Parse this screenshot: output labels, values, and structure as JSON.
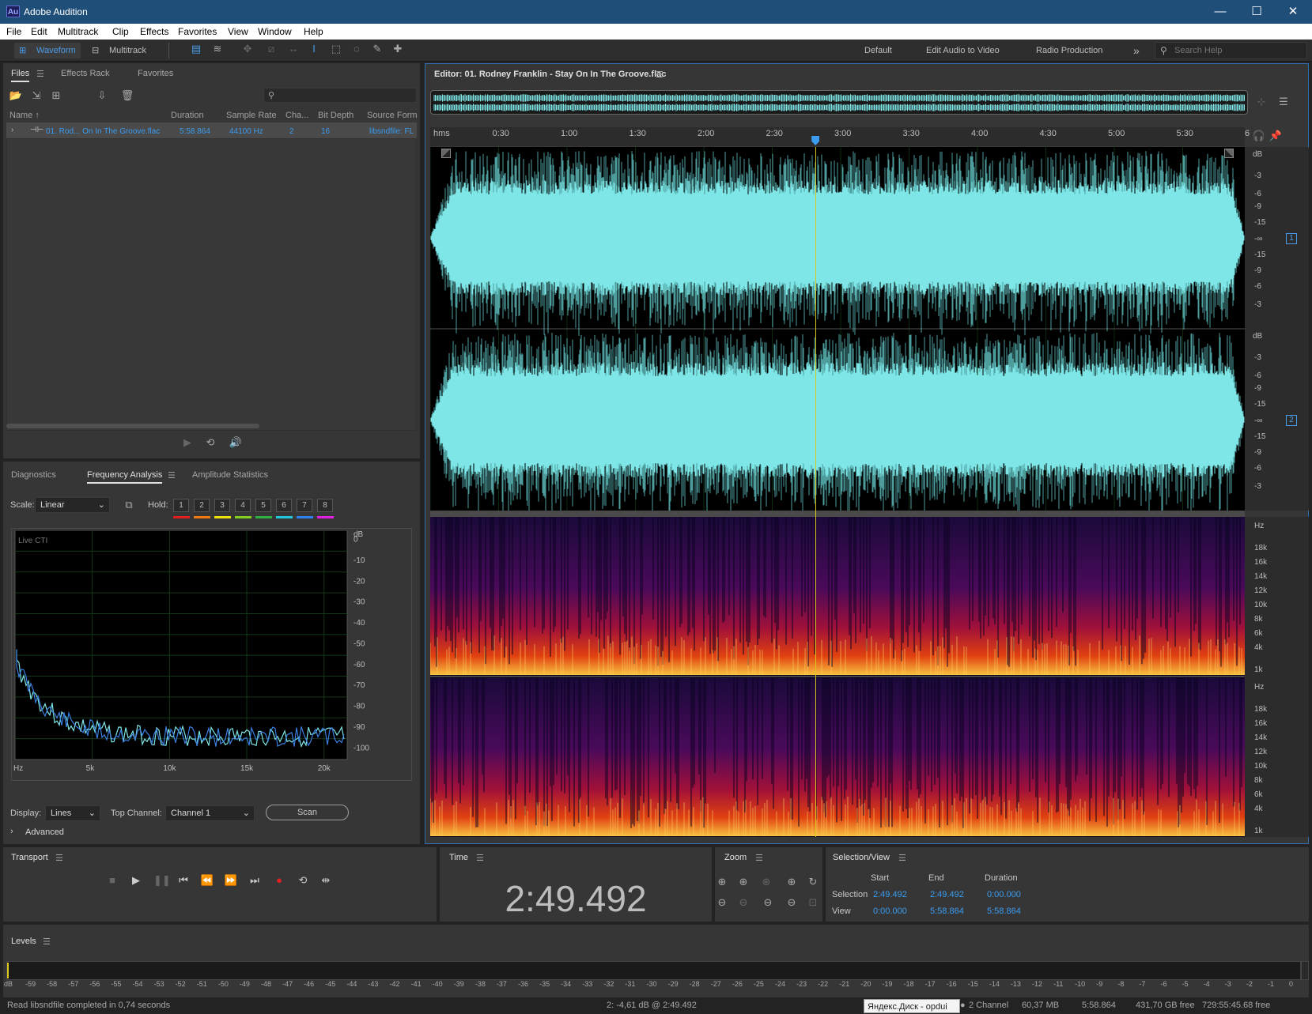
{
  "app": {
    "logo": "Au",
    "title": "Adobe Audition"
  },
  "window_controls": {
    "minimize": "—",
    "maximize": "☐",
    "close": "✕"
  },
  "menu": [
    "File",
    "Edit",
    "Multitrack",
    "Clip",
    "Effects",
    "Favorites",
    "View",
    "Window",
    "Help"
  ],
  "toolbar": {
    "waveform_label": "Waveform",
    "multitrack_label": "Multitrack"
  },
  "workspaces": [
    "Default",
    "Edit Audio to Video",
    "Radio Production"
  ],
  "overflow_label": "»",
  "search_help": {
    "placeholder": "Search Help"
  },
  "files_panel": {
    "tabs": [
      "Files",
      "Effects Rack",
      "Favorites"
    ],
    "columns": [
      "Name ↑",
      "Duration",
      "Sample Rate",
      "Cha...",
      "Bit Depth",
      "Source Form..."
    ],
    "file": {
      "name": "01. Rod... On In The Groove.flac",
      "duration": "5:58.864",
      "sample_rate": "44100 Hz",
      "channels": "2",
      "bit_depth": "16",
      "source_format": "libsndfile: FL"
    }
  },
  "analysis_panel": {
    "tabs": [
      "Diagnostics",
      "Frequency Analysis",
      "Amplitude Statistics"
    ],
    "scale_label": "Scale:",
    "scale_value": "Linear",
    "hold_label": "Hold:",
    "hold_buttons": [
      "1",
      "2",
      "3",
      "4",
      "5",
      "6",
      "7",
      "8"
    ],
    "hold_colors": [
      "#e0201c",
      "#f07a10",
      "#f0e010",
      "#80d020",
      "#30b040",
      "#20c8e0",
      "#3080f0",
      "#e020e0"
    ],
    "graph_label": "Live CTI",
    "x_ticks": [
      "Hz",
      "5k",
      "10k",
      "15k",
      "20k"
    ],
    "db_ticks": [
      "dB",
      "0",
      "-10",
      "-20",
      "-30",
      "-40",
      "-50",
      "-60",
      "-70",
      "-80",
      "-90",
      "-100"
    ],
    "display_label": "Display:",
    "display_value": "Lines",
    "top_channel_label": "Top Channel:",
    "top_channel_value": "Channel 1",
    "scan_label": "Scan",
    "advanced_label": "Advanced"
  },
  "editor": {
    "title": "Editor: 01. Rodney Franklin - Stay On In The Groove.flac",
    "ruler": [
      "hms",
      "0:30",
      "1:00",
      "1:30",
      "2:00",
      "2:30",
      "3:00",
      "3:30",
      "4:00",
      "4:30",
      "5:00",
      "5:30",
      "6"
    ],
    "db_scale": [
      "dB",
      "-3",
      "-6",
      "-9",
      "-15",
      "-∞",
      "-15",
      "-9",
      "-6",
      "-3"
    ],
    "hz_scale": [
      "Hz",
      "18k",
      "16k",
      "14k",
      "12k",
      "10k",
      "8k",
      "6k",
      "4k",
      "1k"
    ],
    "channel_1": "1",
    "channel_2": "2",
    "playhead_fraction": 0.473
  },
  "transport": {
    "title": "Transport"
  },
  "time": {
    "title": "Time",
    "value": "2:49.492"
  },
  "zoom": {
    "title": "Zoom"
  },
  "selection_view": {
    "title": "Selection/View",
    "headers": [
      "Start",
      "End",
      "Duration"
    ],
    "rows": [
      {
        "label": "Selection",
        "start": "2:49.492",
        "end": "2:49.492",
        "duration": "0:00.000"
      },
      {
        "label": "View",
        "start": "0:00.000",
        "end": "5:58.864",
        "duration": "5:58.864"
      }
    ]
  },
  "levels": {
    "title": "Levels",
    "ticks": [
      "dB",
      "-59",
      "-58",
      "-57",
      "-56",
      "-55",
      "-54",
      "-53",
      "-52",
      "-51",
      "-50",
      "-49",
      "-48",
      "-47",
      "-46",
      "-45",
      "-44",
      "-43",
      "-42",
      "-41",
      "-40",
      "-39",
      "-38",
      "-37",
      "-36",
      "-35",
      "-34",
      "-33",
      "-32",
      "-31",
      "-30",
      "-29",
      "-28",
      "-27",
      "-26",
      "-25",
      "-24",
      "-23",
      "-22",
      "-21",
      "-20",
      "-19",
      "-18",
      "-17",
      "-16",
      "-15",
      "-14",
      "-13",
      "-12",
      "-11",
      "-10",
      "-9",
      "-8",
      "-7",
      "-6",
      "-5",
      "-4",
      "-3",
      "-2",
      "-1",
      "0"
    ]
  },
  "status": {
    "message": "Read libsndfile completed in 0,74 seconds",
    "cursor": "2: -4,61 dB @ 2:49.492",
    "tooltip": "Яндекс.Диск - opdui",
    "channel": "2 Channel",
    "size": "60,37 MB",
    "duration": "5:58.864",
    "free": "431,70 GB free",
    "free_time": "729:55:45.68 free"
  }
}
